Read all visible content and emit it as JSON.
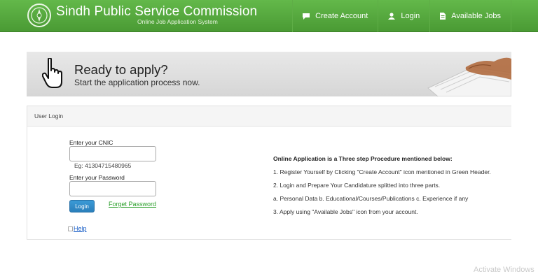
{
  "header": {
    "title": "Sindh Public Service Commission",
    "subtitle": "Online Job Application System",
    "nav": [
      {
        "label": "Create Account",
        "icon": "chat-icon"
      },
      {
        "label": "Login",
        "icon": "user-icon"
      },
      {
        "label": "Available Jobs",
        "icon": "document-icon"
      }
    ]
  },
  "banner": {
    "title": "Ready to apply?",
    "subtitle": "Start the application process now."
  },
  "login": {
    "panel_title": "User Login",
    "cnic_label": "Enter your CNIC",
    "cnic_value": "",
    "cnic_hint": "Eg: 41304715480965",
    "password_label": "Enter your Password",
    "password_value": "",
    "login_button": "Login",
    "forget_link": "Forget Password",
    "help_link": "Help"
  },
  "procedure": {
    "title": "Online Application is a Three step Procedure mentioned below:",
    "steps": [
      "1. Register Yourself by Clicking \"Create Account\" icon mentioned in Green Header.",
      "2. Login and Prepare Your Candidature splitted into three parts.",
      "a. Personal Data b. Educational/Courses/Publications c. Experience if any",
      "3. Apply using \"Available Jobs\" icon from your account."
    ]
  },
  "watermark": "Activate Windows",
  "colors": {
    "header_green": "#55a83d",
    "button_blue": "#2b7fbb",
    "link_green": "#2ca02c"
  }
}
